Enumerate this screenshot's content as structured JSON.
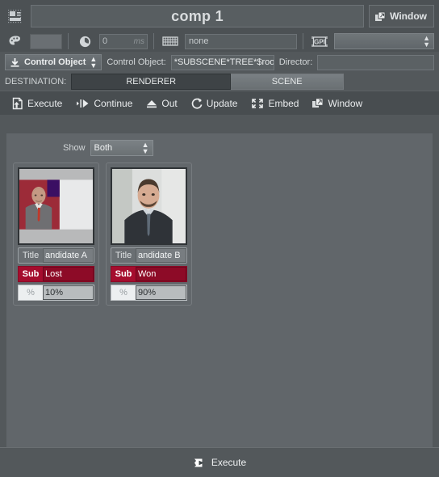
{
  "titlebar": {
    "app_icon": "layout-icon",
    "comp_name": "comp 1",
    "window_button": "Window",
    "window_icon": "window-restore-icon"
  },
  "properties_row": {
    "palette_icon": "palette-icon",
    "color_swatch": "",
    "clock_icon": "clock-icon",
    "duration_value": "0",
    "duration_unit": "ms",
    "keyboard_icon": "keyboard-icon",
    "shortcut_value": "none",
    "gpi_icon": "gpi-icon",
    "gpi_value": ""
  },
  "control_row": {
    "mode_button": "Control Object",
    "mode_icon": "download-arrow-icon",
    "control_object_label": "Control Object:",
    "control_object_value": "*SUBSCENE*TREE*$root",
    "director_label": "Director:",
    "director_value": ""
  },
  "destination_row": {
    "label": "DESTINATION:",
    "options": [
      "RENDERER",
      "SCENE"
    ],
    "selected": "RENDERER"
  },
  "toolbar": {
    "items": [
      {
        "label": "Execute",
        "icon": "execute-page-icon"
      },
      {
        "label": "Continue",
        "icon": "continue-play-icon"
      },
      {
        "label": "Out",
        "icon": "out-eject-icon"
      },
      {
        "label": "Update",
        "icon": "update-refresh-icon"
      },
      {
        "label": "Embed",
        "icon": "embed-expand-icon"
      },
      {
        "label": "Window",
        "icon": "window-restore-icon"
      }
    ]
  },
  "content": {
    "show_label": "Show",
    "show_value": "Both",
    "cards": [
      {
        "thumbnail": "candidate-a-photo",
        "title_key": "Title",
        "title_value": "andidate A",
        "sub_key": "Sub",
        "sub_value": "Lost",
        "pct_key": "%",
        "pct_value": "10%"
      },
      {
        "thumbnail": "candidate-b-photo",
        "title_key": "Title",
        "title_value": "andidate B",
        "sub_key": "Sub",
        "sub_value": "Won",
        "pct_key": "%",
        "pct_value": "90%"
      }
    ]
  },
  "footer": {
    "execute_label": "Execute",
    "execute_icon": "execute-play-icon"
  },
  "colors": {
    "accent_red": "#a50d2e",
    "panel_bg": "#53585b",
    "content_bg": "#61666a",
    "toolbar_bg": "#484d50",
    "field_bg": "#585e61"
  }
}
